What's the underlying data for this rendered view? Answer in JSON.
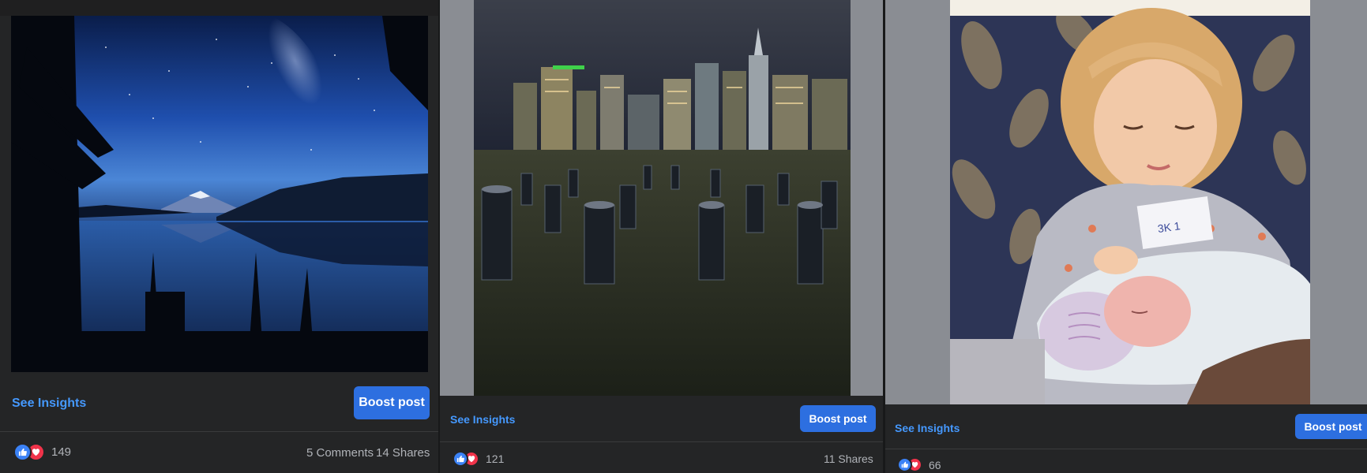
{
  "posts": [
    {
      "insights_label": "See Insights",
      "boost_label": "Boost post",
      "reaction_count": "149",
      "comments": "5 Comments",
      "shares": "14 Shares",
      "photo_subject": "starry night sky over mountain lake"
    },
    {
      "insights_label": "See Insights",
      "boost_label": "Boost post",
      "reaction_count": "121",
      "shares": "11 Shares",
      "photo_subject": "city skyline at night behind pier pilings"
    },
    {
      "insights_label": "See Insights",
      "boost_label": "Boost post",
      "reaction_count": "66",
      "photo_subject": "child holding newborn baby"
    }
  ],
  "colors": {
    "link": "#4599ff",
    "boost_button": "#2d6fe0",
    "like": "#3b82f6",
    "love": "#f0334a",
    "panel_bg": "#242526"
  },
  "icons": {
    "like": "thumbs-up-icon",
    "love": "heart-icon"
  }
}
